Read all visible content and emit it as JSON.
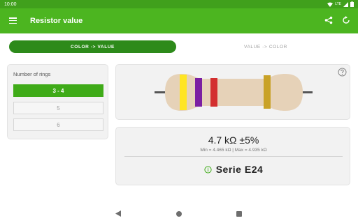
{
  "status_bar": {
    "time": "10:00",
    "network": "LTE"
  },
  "app_bar": {
    "title": "Resistor value",
    "icons": [
      "menu-icon",
      "share-icon",
      "refresh-icon"
    ]
  },
  "tabs": [
    {
      "label": "COLOR -> VALUE",
      "active": true
    },
    {
      "label": "VALUE -> COLOR",
      "active": false
    }
  ],
  "rings_panel": {
    "title": "Number of rings",
    "options": [
      {
        "label": "3 - 4",
        "selected": true
      },
      {
        "label": "5",
        "selected": false
      },
      {
        "label": "6",
        "selected": false
      }
    ]
  },
  "resistor": {
    "bands": [
      "yellow",
      "violet",
      "red",
      "gold"
    ],
    "colors": {
      "body": "#e6d2b8",
      "yellow": "#ffe523",
      "violet": "#7b1fa2",
      "red": "#d32f2f",
      "gold": "#c9a227"
    }
  },
  "result": {
    "value": "4.7 kΩ ±5%",
    "min_max": "Min = 4.465 kΩ | Max = 4.935 kΩ",
    "series": "Serie E24"
  },
  "colors": {
    "status_bar": "#40a01c",
    "app_bar": "#4cb520",
    "accent": "#2d8a1a",
    "selected": "#3fab18"
  }
}
